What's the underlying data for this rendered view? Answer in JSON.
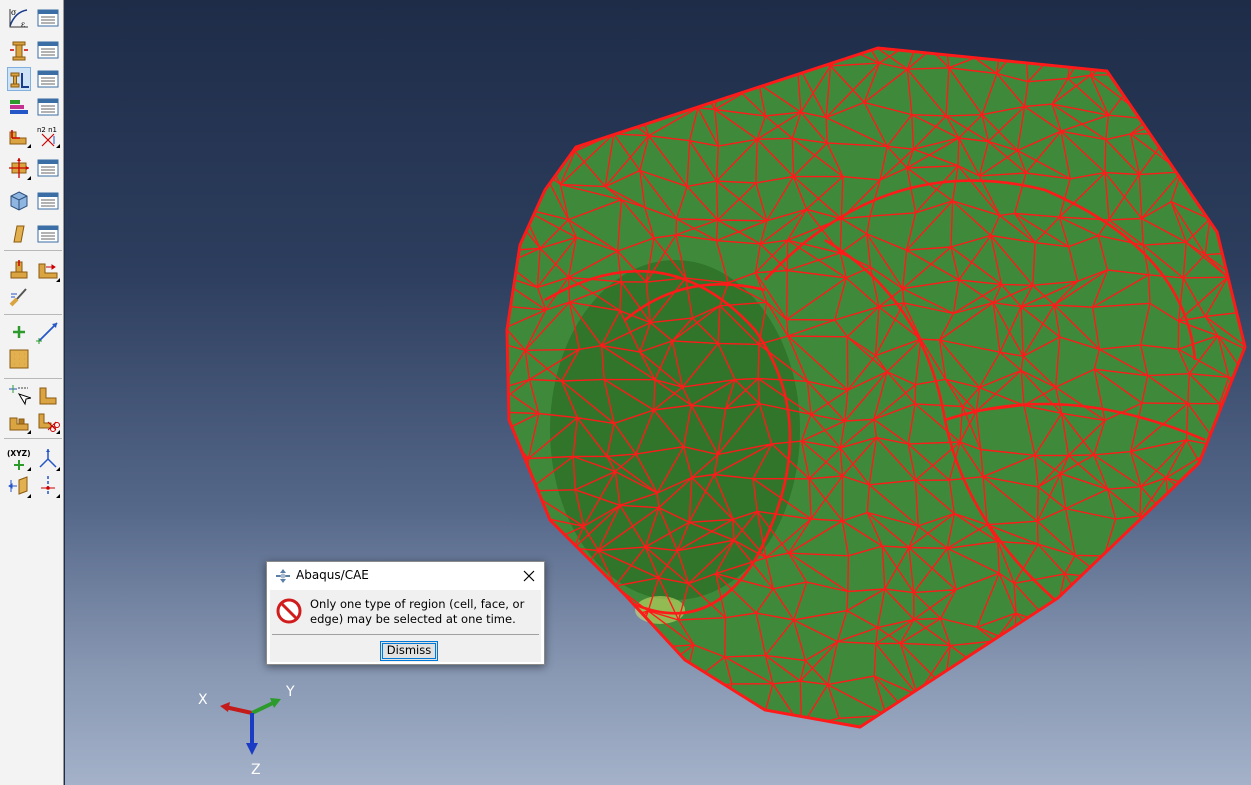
{
  "toolbox": {
    "tools": [
      {
        "icon": "material-stress-strain-icon",
        "selected": false
      },
      {
        "icon": "material-manager-icon",
        "selected": false
      },
      {
        "icon": "create-section-icon",
        "selected": false
      },
      {
        "icon": "section-manager-icon",
        "selected": false
      },
      {
        "icon": "assign-section-icon",
        "selected": true
      },
      {
        "icon": "section-assignment-manager-icon",
        "selected": false
      },
      {
        "icon": "create-profile-icon",
        "selected": false
      },
      {
        "icon": "profile-manager-icon",
        "selected": false
      },
      {
        "icon": "assign-beam-orientation-icon",
        "selected": false
      },
      {
        "icon": "assign-normals-icon",
        "selected": false
      },
      {
        "icon": "create-skin-icon",
        "selected": false
      },
      {
        "icon": "skin-manager-icon",
        "selected": false
      },
      {
        "icon": "create-composite-layup-icon",
        "selected": false
      },
      {
        "icon": "composite-layup-manager-icon",
        "selected": false
      },
      {
        "icon": "create-inertia-icon",
        "selected": false
      },
      {
        "icon": "inertia-manager-icon",
        "selected": false
      },
      {
        "icon": "special-skin-icon",
        "selected": false
      },
      {
        "icon": "assign-material-orientation-icon",
        "selected": false
      },
      {
        "icon": "assign-rebar-icon",
        "selected": false
      },
      {
        "icon": "create-point-icon",
        "selected": false
      },
      {
        "icon": "create-datum-axis-icon",
        "selected": false
      },
      {
        "icon": "mesh-seed-icon",
        "selected": false
      },
      {
        "icon": "partition-edge-icon",
        "selected": false
      },
      {
        "icon": "partition-cell-icon",
        "selected": false
      },
      {
        "icon": "partition-face-icon",
        "selected": false
      },
      {
        "icon": "repair-cut-icon",
        "selected": false
      },
      {
        "icon": "datum-point-icon",
        "selected": false
      },
      {
        "icon": "datum-csys-icon",
        "selected": false
      },
      {
        "icon": "datum-plane-icon",
        "selected": false
      },
      {
        "icon": "datum-axis-icon",
        "selected": false
      }
    ]
  },
  "viewport": {
    "model_fill": "#3f8a3a",
    "mesh_color": "#ff1a1a",
    "triad": {
      "x_label": "X",
      "y_label": "Y",
      "z_label": "Z"
    }
  },
  "dialog": {
    "title": "Abaqus/CAE",
    "message": "Only one type of region (cell, face, or edge) may be selected at one time.",
    "button_label": "Dismiss",
    "icon": "error-icon",
    "close_icon": "close-icon"
  }
}
